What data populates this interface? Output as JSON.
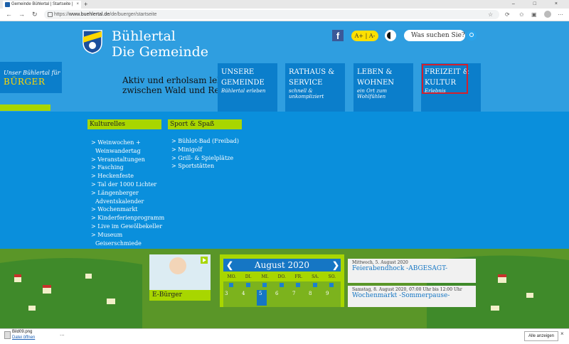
{
  "browser": {
    "tab_title": "Gemeinde Bühlertal | Startseite |",
    "tab_close": "×",
    "new_tab": "+",
    "window_controls": "– □ ×",
    "url_domain": "www.buehlertal.de",
    "url_prefix": "https://",
    "url_path": "/de/buerger/startseite",
    "nav": {
      "back": "←",
      "forward": "→",
      "reload": "↻"
    }
  },
  "header": {
    "site_name_line1": "Bühlertal",
    "site_name_line2": "Die Gemeinde",
    "facebook": "f",
    "font_size": "A+ | A-",
    "search_placeholder": "Was suchen Sie?",
    "buerger_line1": "Unser Bühlertal für",
    "buerger_line2": "BÜRGER",
    "tagline_line1": "Aktiv und erholsam leben",
    "tagline_line2": "zwischen Wald und Reben"
  },
  "main_nav": [
    {
      "title1": "UNSERE",
      "title2": "GEMEINDE",
      "sub": "Bühlertal erleben"
    },
    {
      "title1": "RATHAUS &",
      "title2": "SERVICE",
      "sub": "schnell & unkompliziert"
    },
    {
      "title1": "LEBEN &",
      "title2": "WOHNEN",
      "sub": "ein Ort zum Wohlfühlen"
    },
    {
      "title1": "FREIZEIT &",
      "title2": "KULTUR",
      "sub": "Erlebnis"
    }
  ],
  "dropdown": {
    "kulturelles": {
      "heading": "Kulturelles",
      "items": [
        "> Weinwochen +",
        "Weinwandertag",
        "> Veranstaltungen",
        "> Fasching",
        "> Heckenfeste",
        "> Tal der 1000 Lichter",
        "> Längenberger",
        "Adventskalender",
        "> Wochenmarkt",
        "> Kinderferienprogramm",
        "> Live im Gewölbekeller",
        "> Museum",
        "Geiserschmiede"
      ]
    },
    "sport": {
      "heading": "Sport & Spaß",
      "items": [
        "> Bühlot-Bad (Freibad)",
        "> Minigolf",
        "> Grill- & Spielplätze",
        "> Sportstätten"
      ]
    }
  },
  "ebuerger": {
    "label": "E-Bürger"
  },
  "calendar": {
    "month": "August 2020",
    "prev": "❮",
    "next": "❯",
    "days": [
      "MO.",
      "DI.",
      "MI.",
      "DO.",
      "FR.",
      "SA.",
      "SO."
    ],
    "row1": [
      "3",
      "4",
      "5",
      "6",
      "7",
      "8",
      "9"
    ]
  },
  "events": [
    {
      "date": "Mittwoch, 5. August 2020",
      "title": "Feierabendhock -ABGESAGT-"
    },
    {
      "date": "Samstag, 8. August 2020, 07:00 Uhr bis 12:00 Uhr",
      "title": "Wochenmarkt -Sommerpause-"
    }
  ],
  "download_bar": {
    "filename": "Bild09.png",
    "open": "Datei öffnen",
    "more": "...",
    "show_all": "Alle anzeigen",
    "close": "×"
  },
  "colors": {
    "page_blue": "#0a8fdc",
    "header_blue": "#2f9ee0",
    "nav_blue": "#0b7ecb",
    "accent_green": "#a8d600",
    "highlight_red": "#d4202c"
  }
}
